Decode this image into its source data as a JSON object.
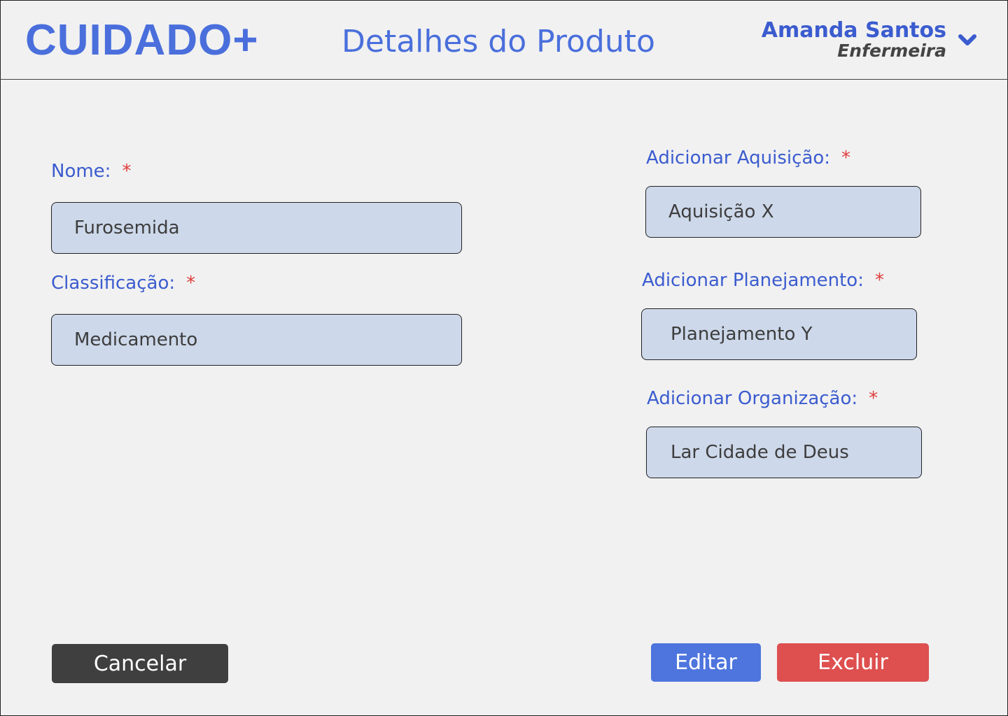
{
  "app": {
    "logo": "CUIDADO+",
    "page_title": "Detalhes do Produto"
  },
  "user": {
    "name": "Amanda Santos",
    "role": "Enfermeira",
    "menu_icon": "chevron-down-icon"
  },
  "required_marker": "*",
  "form": {
    "nome": {
      "label": "Nome:",
      "value": "Furosemida"
    },
    "classificacao": {
      "label": "Classificação:",
      "value": "Medicamento"
    },
    "aquisicao": {
      "label": "Adicionar Aquisição:",
      "value": "Aquisição X"
    },
    "planejamento": {
      "label": "Adicionar Planejamento:",
      "value": "Planejamento Y"
    },
    "organizacao": {
      "label": "Adicionar Organização:",
      "value": "Lar Cidade de Deus"
    }
  },
  "actions": {
    "cancel": "Cancelar",
    "edit": "Editar",
    "delete": "Excluir"
  },
  "colors": {
    "accent": "#4a6fdc",
    "required": "#e03b3b",
    "field_bg": "#cdd8ea",
    "cancel_bg": "#3f3f3f",
    "edit_bg": "#4e75de",
    "delete_bg": "#de4f4f"
  }
}
